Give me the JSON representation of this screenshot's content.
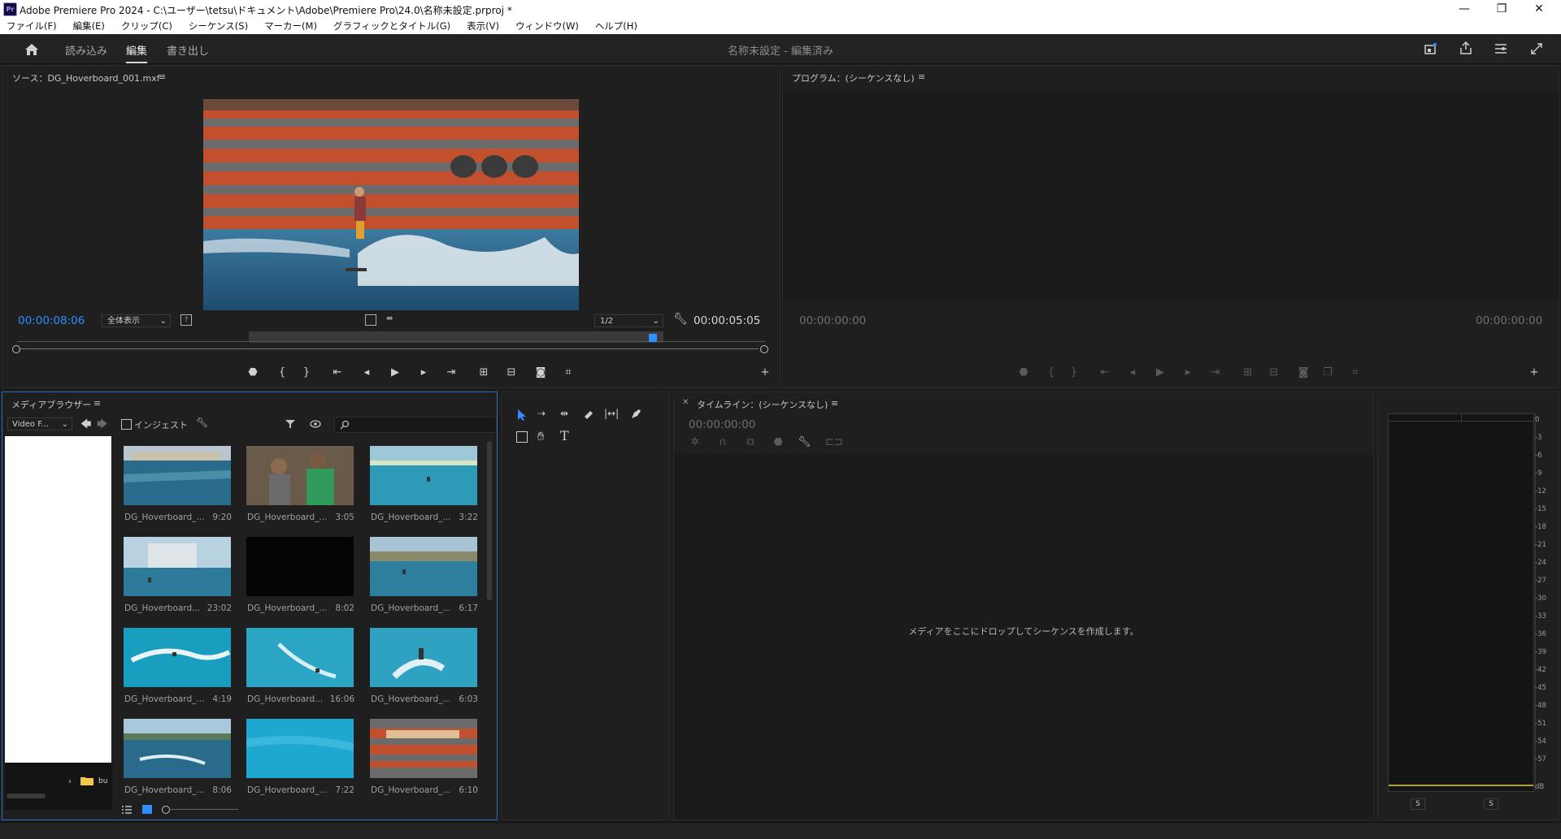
{
  "window": {
    "title": "Adobe Premiere Pro 2024 - C:\\ユーザー\\tetsu\\ドキュメント\\Adobe\\Premiere Pro\\24.0\\名称未設定.prproj *",
    "app_icon": "Pr",
    "minimize": "—",
    "maximize": "❐",
    "close": "✕"
  },
  "menu": [
    "ファイル(F)",
    "編集(E)",
    "クリップ(C)",
    "シーケンス(S)",
    "マーカー(M)",
    "グラフィックとタイトル(G)",
    "表示(V)",
    "ウィンドウ(W)",
    "ヘルプ(H)"
  ],
  "workspace": {
    "tabs": [
      "読み込み",
      "編集",
      "書き出し"
    ],
    "active_tab": "編集",
    "project_status": "名称未設定 - 編集済み"
  },
  "source_monitor": {
    "title": "ソース：DG_Hoverboard_001.mxf",
    "timecode_current": "00:00:08:06",
    "zoom": "全体表示",
    "resolution": "1/2",
    "timecode_duration": "00:00:05:05",
    "playhead_fraction": 0.85
  },
  "program_monitor": {
    "title": "プログラム：(シーケンスなし)",
    "timecode_left": "00:00:00:00",
    "timecode_right": "00:00:00:00"
  },
  "media_browser": {
    "title": "メディアブラウザー",
    "filter_select": "Video F...",
    "ingest_label": "インジェスト",
    "folder_label": "bu",
    "items": [
      {
        "name": "DG_Hoverboard_...",
        "duration": "9:20"
      },
      {
        "name": "DG_Hoverboard_...",
        "duration": "3:05"
      },
      {
        "name": "DG_Hoverboard_...",
        "duration": "3:22"
      },
      {
        "name": "DG_Hoverboard...",
        "duration": "23:02"
      },
      {
        "name": "DG_Hoverboard_...",
        "duration": "8:02"
      },
      {
        "name": "DG_Hoverboard_...",
        "duration": "6:17"
      },
      {
        "name": "DG_Hoverboard_...",
        "duration": "4:19"
      },
      {
        "name": "DG_Hoverboard...",
        "duration": "16:06"
      },
      {
        "name": "DG_Hoverboard_...",
        "duration": "6:03"
      },
      {
        "name": "DG_Hoverboard_...",
        "duration": "8:06"
      },
      {
        "name": "DG_Hoverboard_...",
        "duration": "7:22"
      },
      {
        "name": "DG_Hoverboard_...",
        "duration": "6:10"
      }
    ]
  },
  "timeline": {
    "title": "タイムライン：(シーケンスなし)",
    "timecode": "00:00:00:00",
    "drop_message": "メディアをここにドロップしてシーケンスを作成します。"
  },
  "audio_meter": {
    "scale": [
      "0",
      "-3",
      "-6",
      "-9",
      "-12",
      "-15",
      "-18",
      "-21",
      "-24",
      "-27",
      "-30",
      "-33",
      "-36",
      "-39",
      "-42",
      "-45",
      "-48",
      "-51",
      "-54",
      "-57",
      "dB"
    ],
    "solo_left": "S",
    "solo_right": "S"
  },
  "colors": {
    "accent_blue": "#2f8dff",
    "panel_bg": "#1f1f1f",
    "app_bg": "#1d1d1d"
  }
}
